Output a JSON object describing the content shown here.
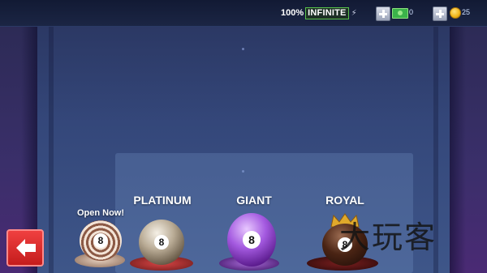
{
  "hud": {
    "energy_percent": "100%",
    "energy_status": "INFINITE",
    "cash_count": "0",
    "coin_count": "25"
  },
  "tiers": [
    {
      "name": "PLATINUM",
      "ball_color": "#9a8e7c",
      "accent": "#c63b3b"
    },
    {
      "name": "GIANT",
      "ball_color": "#8c3fc4",
      "accent": "#b77ae8"
    },
    {
      "name": "ROYAL",
      "ball_color": "#3a1e12",
      "accent": "#d9a227"
    }
  ],
  "featured": {
    "label": "Open Now!",
    "ball_color": "#d9c2b0"
  },
  "watermark": "大玩客",
  "colors": {
    "back_button": "#e53030",
    "energy_badge_border": "#58c24a",
    "background": "#34477a"
  },
  "icons": {
    "back": "left-arrow-icon",
    "energy": "lightning-bolt-icon",
    "cash": "cash-bill-icon",
    "coin": "gold-coin-icon",
    "add": "plus-icon"
  }
}
